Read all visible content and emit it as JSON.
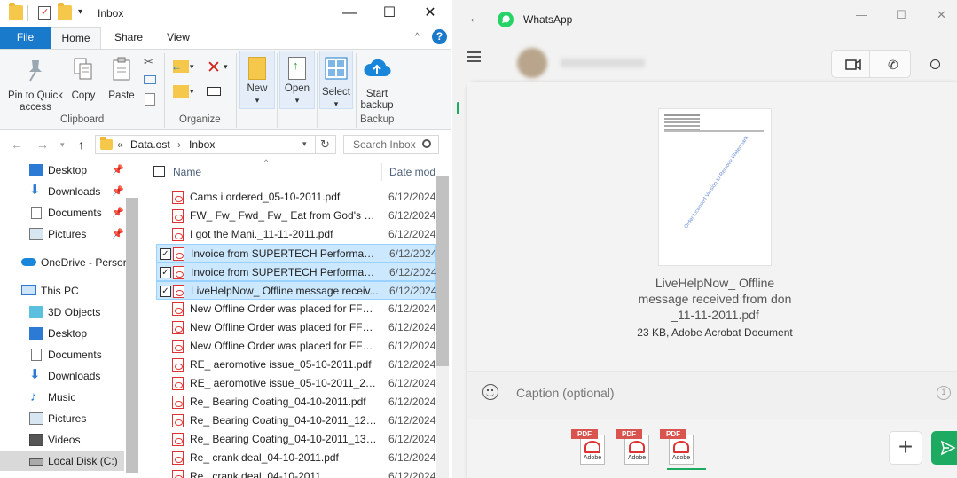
{
  "explorer": {
    "window_title": "Inbox",
    "controls": {
      "minimize": "—",
      "maximize": "☐",
      "close": "✕"
    },
    "tabs": [
      {
        "label": "File"
      },
      {
        "label": "Home"
      },
      {
        "label": "Share"
      },
      {
        "label": "View"
      }
    ],
    "ribbon": {
      "clipboard": {
        "pin_to_quick": "Pin to Quick",
        "pin_access": "access",
        "copy": "Copy",
        "paste": "Paste",
        "group": "Clipboard"
      },
      "organize": {
        "group": "Organize"
      },
      "new": "New",
      "open": "Open",
      "select": "Select",
      "backup": {
        "start": "Start",
        "backup": "backup",
        "group": "Backup"
      }
    },
    "address": {
      "prefix": "«",
      "parts": [
        "Data.ost",
        "Inbox"
      ],
      "search_placeholder": "Search Inbox"
    },
    "nav": [
      {
        "label": "Desktop",
        "pinned": true
      },
      {
        "label": "Downloads",
        "pinned": true
      },
      {
        "label": "Documents",
        "pinned": true
      },
      {
        "label": "Pictures",
        "pinned": true
      },
      {
        "label": "OneDrive - Persor",
        "pinned": false
      },
      {
        "label": "This PC",
        "pinned": false
      },
      {
        "label": "3D Objects",
        "pinned": false
      },
      {
        "label": "Desktop",
        "pinned": false
      },
      {
        "label": "Documents",
        "pinned": false
      },
      {
        "label": "Downloads",
        "pinned": false
      },
      {
        "label": "Music",
        "pinned": false
      },
      {
        "label": "Pictures",
        "pinned": false
      },
      {
        "label": "Videos",
        "pinned": false
      },
      {
        "label": "Local Disk (C:)",
        "pinned": false
      }
    ],
    "columns": {
      "name": "Name",
      "date": "Date mod"
    },
    "files": [
      {
        "name": "Cams i ordered_05-10-2011.pdf",
        "date": "6/12/2024",
        "selected": false
      },
      {
        "name": "FW_ Fw_ Fwd_ Fw_ Eat from God's gar...",
        "date": "6/12/2024",
        "selected": false
      },
      {
        "name": "I got the Mani._11-11-2011.pdf",
        "date": "6/12/2024",
        "selected": false
      },
      {
        "name": "Invoice from SUPERTECH Performanc...",
        "date": "6/12/2024",
        "selected": true
      },
      {
        "name": "Invoice from SUPERTECH Performanc...",
        "date": "6/12/2024",
        "selected": true
      },
      {
        "name": "LiveHelpNow_ Offline message receiv...",
        "date": "6/12/2024",
        "selected": true
      },
      {
        "name": "New Offline Order was placed for FFW...",
        "date": "6/12/2024",
        "selected": false
      },
      {
        "name": "New Offline Order was placed for FFW...",
        "date": "6/12/2024",
        "selected": false
      },
      {
        "name": "New Offline Order was placed for FFW...",
        "date": "6/12/2024",
        "selected": false
      },
      {
        "name": "RE_ aeromotive issue_05-10-2011.pdf",
        "date": "6/12/2024",
        "selected": false
      },
      {
        "name": "RE_ aeromotive issue_05-10-2011_24.pdf",
        "date": "6/12/2024",
        "selected": false
      },
      {
        "name": "Re_ Bearing Coating_04-10-2011.pdf",
        "date": "6/12/2024",
        "selected": false
      },
      {
        "name": "Re_ Bearing Coating_04-10-2011_12.pdf",
        "date": "6/12/2024",
        "selected": false
      },
      {
        "name": "Re_ Bearing Coating_04-10-2011_13.pdf",
        "date": "6/12/2024",
        "selected": false
      },
      {
        "name": "Re_ crank deal_04-10-2011.pdf",
        "date": "6/12/2024",
        "selected": false
      },
      {
        "name": "Re_ crank deal_04-10-2011...",
        "date": "6/12/2024",
        "selected": false
      }
    ]
  },
  "whatsapp": {
    "title": "WhatsApp",
    "back": "←",
    "preview": {
      "watermark": "Order Licensed Version to Remove Watermark",
      "name_line1": "LiveHelpNow_ Offline",
      "name_line2": "message received from don",
      "name_line3": "_11-11-2011.pdf",
      "meta": "23 KB, Adobe Acrobat Document"
    },
    "caption_placeholder": "Caption (optional)",
    "tray": [
      {
        "label": "PDF",
        "brand": "Adobe"
      },
      {
        "label": "PDF",
        "brand": "Adobe"
      },
      {
        "label": "PDF",
        "brand": "Adobe"
      }
    ],
    "add": "+",
    "send_count": "3",
    "accent": "#1dab61"
  }
}
